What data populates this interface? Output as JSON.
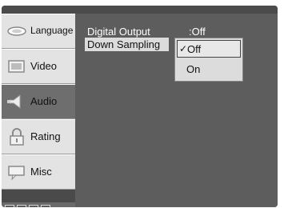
{
  "sidebar": {
    "items": [
      {
        "label": "Language",
        "icon": "language-icon",
        "active": false
      },
      {
        "label": "Video",
        "icon": "video-icon",
        "active": false
      },
      {
        "label": "Audio",
        "icon": "speaker-icon",
        "active": true
      },
      {
        "label": "Rating",
        "icon": "lock-icon",
        "active": false
      },
      {
        "label": "Misc",
        "icon": "misc-icon",
        "active": false
      }
    ]
  },
  "settings": {
    "digital_output": {
      "label": "Digital Output",
      "value": ":Off"
    },
    "down_sampling": {
      "label": "Down Sampling"
    }
  },
  "dropdown": {
    "options": [
      {
        "label": "Off",
        "selected": true
      },
      {
        "label": "On",
        "selected": false
      }
    ],
    "check_mark": "✓"
  },
  "colors": {
    "frame": "#5d5d5d",
    "sidebar_bg": "#e3e3e3",
    "sidebar_active": "#6e6e6e",
    "highlight": "#dcdcdc",
    "text_light": "#ffffff",
    "text_dark": "#111111"
  }
}
